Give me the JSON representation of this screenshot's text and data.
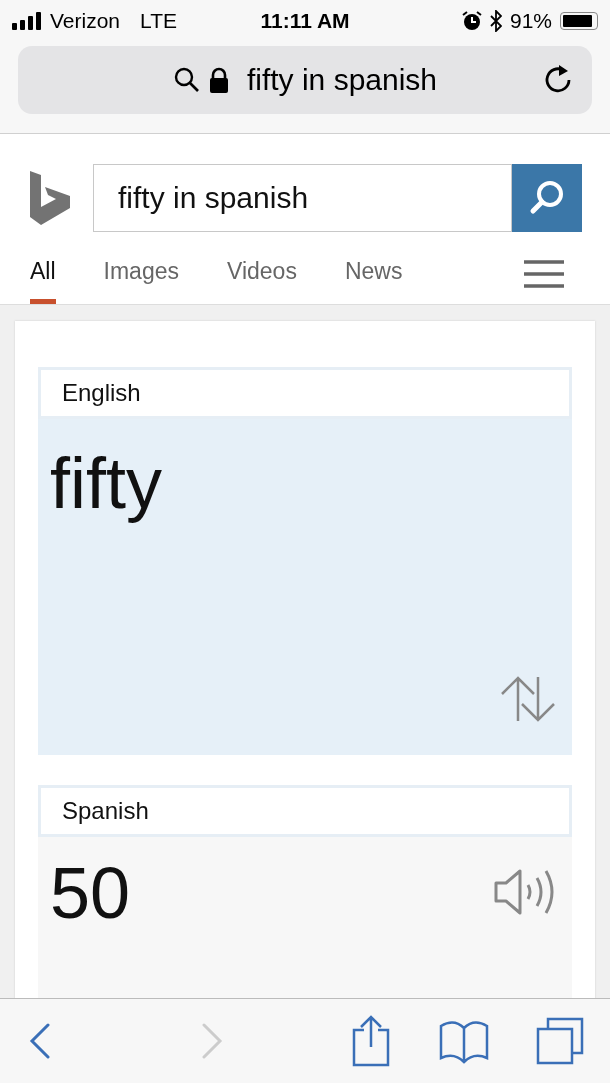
{
  "status_bar": {
    "carrier": "Verizon",
    "network": "LTE",
    "time": "11:11 AM",
    "battery": "91%"
  },
  "address_bar": {
    "text": "fifty in spanish"
  },
  "search": {
    "query": "fifty in spanish"
  },
  "tabs": [
    {
      "label": "All",
      "selected": true
    },
    {
      "label": "Images",
      "selected": false
    },
    {
      "label": "Videos",
      "selected": false
    },
    {
      "label": "News",
      "selected": false
    }
  ],
  "translator": {
    "source": {
      "language": "English",
      "text": "fifty"
    },
    "target": {
      "language": "Spanish",
      "text": "50"
    }
  },
  "toolbar": {
    "back_disabled": false,
    "forward_disabled": true
  }
}
